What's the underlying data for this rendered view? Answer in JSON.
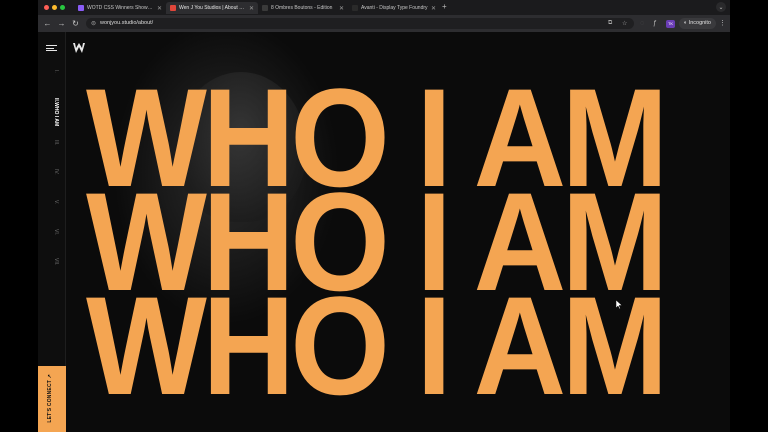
{
  "browser": {
    "tabs": [
      {
        "title": "WOTD CSS Winners Showcase",
        "favicon_color": "#8a5cf6",
        "active": false
      },
      {
        "title": "Wen J You Studios | About Me",
        "favicon_color": "#e0463a",
        "active": true
      },
      {
        "title": "8 Ombres Boutons - Édition",
        "favicon_color": "#3a3a3a",
        "active": false
      },
      {
        "title": "Avanti - Display Type Foundry",
        "favicon_color": "#2a2a2a",
        "active": false
      }
    ],
    "new_tab": "+",
    "url": "wonjyou.studio/about/",
    "incognito_label": "Incognito",
    "extension_badge": "TK"
  },
  "site": {
    "nav_items": [
      {
        "label": "I.",
        "active": false
      },
      {
        "label": "II.WHO I AM",
        "active": true
      },
      {
        "label": "III.",
        "active": false
      },
      {
        "label": "IV.",
        "active": false
      },
      {
        "label": "V.",
        "active": false
      },
      {
        "label": "VI.",
        "active": false
      },
      {
        "label": "VII.",
        "active": false
      }
    ],
    "connect_label": "LET'S CONNECT ↗",
    "headline_lines": [
      "WHO I AM",
      "WHO I AM",
      "WHO I AM"
    ]
  },
  "colors": {
    "accent": "#f4a552",
    "background": "#0b0b0b"
  }
}
